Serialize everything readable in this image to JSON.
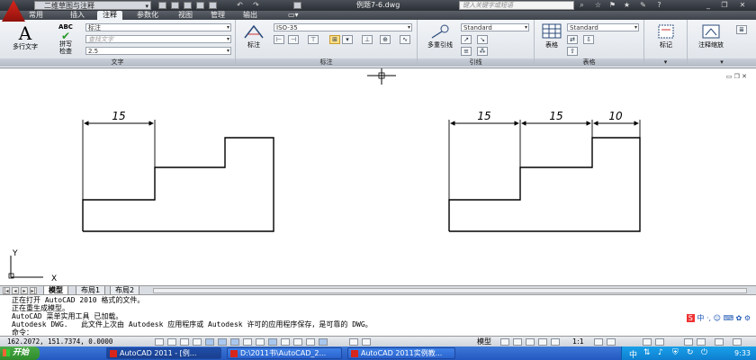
{
  "titlebar": {
    "workspace": "二维草图与注释",
    "document_title": "例题7-6.dwg",
    "search_placeholder": "键入关键字或短语"
  },
  "ribbon_tabs": [
    "常用",
    "插入",
    "注释",
    "参数化",
    "视图",
    "管理",
    "输出"
  ],
  "active_tab": "注释",
  "ribbon": {
    "text_panel": {
      "label": "文字",
      "mtext_label": "多行文字",
      "spell_label_1": "拼写",
      "spell_label_2": "检查",
      "style_value": "标注",
      "find_placeholder": "查找文字",
      "height_value": "2.5"
    },
    "dim_panel": {
      "label": "标注",
      "dim_label": "标注",
      "dimstyle_value": "ISO-35"
    },
    "leader_panel": {
      "label": "引线",
      "multileader_label": "多重引线",
      "style_value": "Standard"
    },
    "table_panel": {
      "label": "表格",
      "table_label": "表格",
      "style_value": "Standard"
    },
    "markup_panel": {
      "label": "标记"
    },
    "scale_panel": {
      "label": "注释缩放"
    }
  },
  "drawing": {
    "left_dims": [
      "15"
    ],
    "right_dims": [
      "15",
      "15",
      "10"
    ],
    "ucs_x": "X",
    "ucs_y": "Y"
  },
  "layout_tabs": [
    "模型",
    "布局1",
    "布局2"
  ],
  "command_lines": [
    "正在打开 AutoCAD 2010 格式的文件。",
    "正在重生成模型。",
    "AutoCAD 菜单实用工具 已加载。",
    "Autodesk DWG.   此文件上次由 Autodesk 应用程序或 Autodesk 许可的应用程序保存，是可靠的 DWG。",
    "命令："
  ],
  "ime_text": "中",
  "statusbar": {
    "coordinates": "162.2072, 151.7374, 0.0000",
    "space_label": "模型",
    "scale_label": "1:1"
  },
  "taskbar": {
    "start_label": "开始",
    "tasks": [
      "AutoCAD 2011 - [例...",
      "D:\\2011书\\AutoCAD_2...",
      "AutoCAD 2011实例教..."
    ],
    "clock": "9:33"
  },
  "colors": {
    "title_bg": "#2a2e35",
    "ribbon_bg": "#e8ecf1",
    "taskbar_bg": "#2459c0",
    "start_green": "#2e8a2b",
    "highlight": "#ffe08a"
  }
}
